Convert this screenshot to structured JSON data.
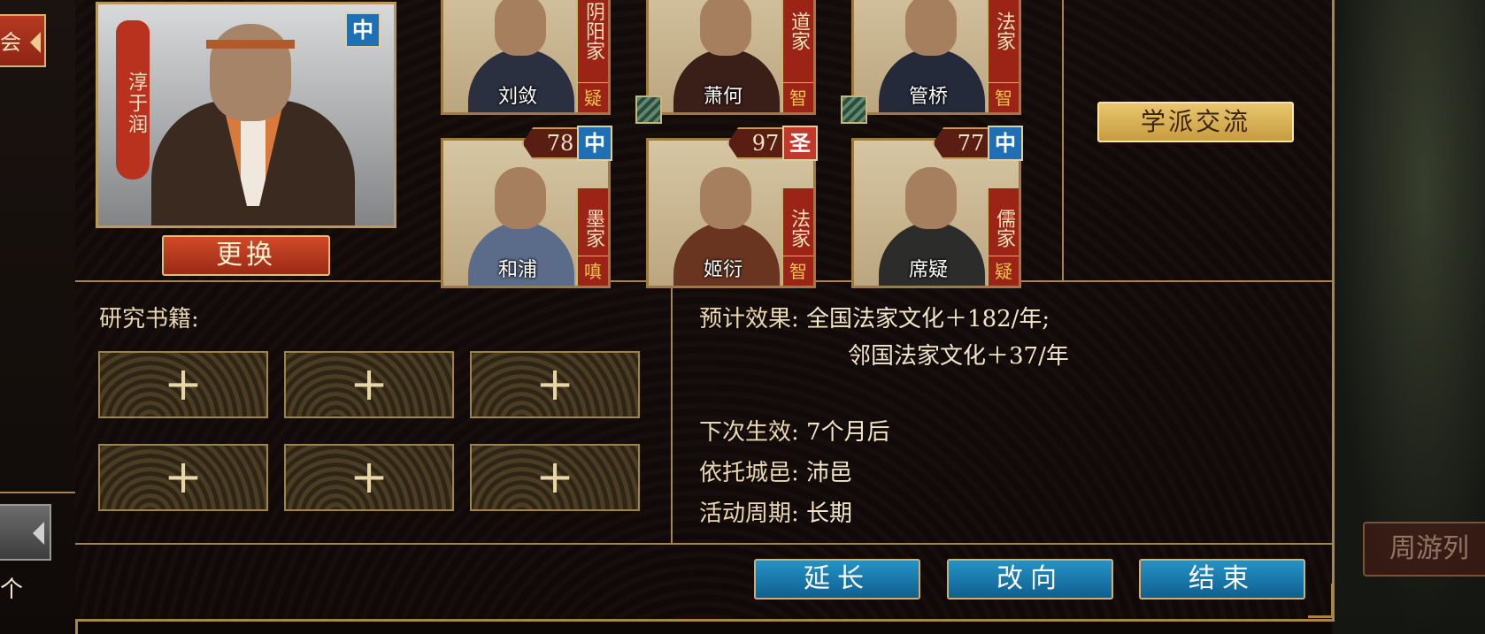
{
  "left_panel": {
    "assoc_button_label": "会",
    "count_label": "个"
  },
  "main_scholar": {
    "name": "淳于润",
    "rank_badge": "中",
    "change_button": "更换"
  },
  "scholars_top_row": [
    {
      "name": "刘敛",
      "school": "阴阳家",
      "trait": "疑"
    },
    {
      "name": "萧何",
      "school": "道家",
      "trait": "智"
    },
    {
      "name": "管桥",
      "school": "法家",
      "trait": "智"
    }
  ],
  "scholars_bottom_row": [
    {
      "name": "和浦",
      "school": "墨家",
      "trait": "嗔",
      "score": "78",
      "rank": "中"
    },
    {
      "name": "姬衍",
      "school": "法家",
      "trait": "智",
      "score": "97",
      "rank": "圣"
    },
    {
      "name": "席疑",
      "school": "儒家",
      "trait": "疑",
      "score": "77",
      "rank": "中"
    }
  ],
  "exchange_button": "学派交流",
  "books": {
    "label": "研究书籍:",
    "slot_symbol": "+"
  },
  "info": {
    "effect_key": "预计效果:",
    "effect_line1": "全国法家文化＋182/年;",
    "effect_line2": "邻国法家文化＋37/年",
    "next_key": "下次生效:",
    "next_value": "7个月后",
    "city_key": "依托城邑:",
    "city_value": "沛邑",
    "period_key": "活动周期:",
    "period_value": "长期"
  },
  "actions": {
    "extend": "延长",
    "redirect": "改向",
    "end": "结束"
  },
  "background": {
    "trip_button": "周游列"
  },
  "colors": {
    "gold_border": "#a68546",
    "red_button": "#b53a22",
    "blue_button": "#1f7fb1",
    "rank_blue": "#1f6fb4",
    "rank_red": "#c2392b"
  }
}
